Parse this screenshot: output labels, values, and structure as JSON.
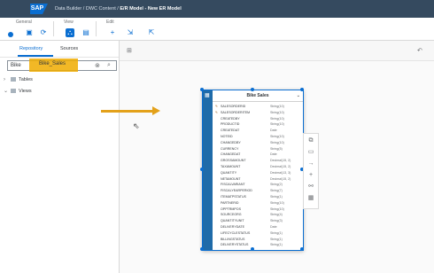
{
  "shell": {
    "logo": "SAP",
    "crumb1": "Data Builder / DWC Content /",
    "crumb2": "E/R Model - New ER Model"
  },
  "toolbar": {
    "general": "General",
    "view": "View",
    "edit": "Edit"
  },
  "left": {
    "tab_repository": "Repository",
    "tab_sources": "Sources",
    "search_value": "Bike",
    "tree": {
      "tables": "Tables",
      "views": "Views",
      "view_item": "Bike_Sales"
    }
  },
  "entity": {
    "title": "Bike Sales",
    "columns": [
      {
        "key": "✎",
        "name": "SALESORDERID",
        "type": "String(10)"
      },
      {
        "key": "✎",
        "name": "SALESORDERITEM",
        "type": "String(10)"
      },
      {
        "key": "",
        "name": "CREATEDBY",
        "type": "String(10)"
      },
      {
        "key": "",
        "name": "PRODUCTID",
        "type": "String(10)"
      },
      {
        "key": "",
        "name": "CREATEDAT",
        "type": "Date"
      },
      {
        "key": "",
        "name": "NOTEID",
        "type": "String(10)"
      },
      {
        "key": "",
        "name": "CHANGEDBY",
        "type": "String(10)"
      },
      {
        "key": "",
        "name": "CURRENCY",
        "type": "String(5)"
      },
      {
        "key": "",
        "name": "CHANGEDAT",
        "type": "Date"
      },
      {
        "key": "",
        "name": "GROSSAMOUNT",
        "type": "Decimal(15, 2)"
      },
      {
        "key": "",
        "name": "TAXAMOUNT",
        "type": "Decimal(15, 2)"
      },
      {
        "key": "",
        "name": "QUANTITY",
        "type": "Decimal(13, 3)"
      },
      {
        "key": "",
        "name": "NETAMOUNT",
        "type": "Decimal(15, 2)"
      },
      {
        "key": "",
        "name": "FISCALVARIANT",
        "type": "String(2)"
      },
      {
        "key": "",
        "name": "FISCALYEARPERIOD",
        "type": "String(7)"
      },
      {
        "key": "",
        "name": "ITEMATPSTATUS",
        "type": "String(1)"
      },
      {
        "key": "",
        "name": "PARTNERID",
        "type": "String(10)"
      },
      {
        "key": "",
        "name": "OPPTRMPOS",
        "type": "String(10)"
      },
      {
        "key": "",
        "name": "SOURCEORG",
        "type": "String(4)"
      },
      {
        "key": "",
        "name": "QUANTITYUNIT",
        "type": "String(3)"
      },
      {
        "key": "",
        "name": "DELIVERYDATE",
        "type": "Date"
      },
      {
        "key": "",
        "name": "LIFECYCLESTATUS",
        "type": "String(1)"
      },
      {
        "key": "",
        "name": "BILLINGSTATUS",
        "type": "String(1)"
      },
      {
        "key": "",
        "name": "DELIVERYSTATUS",
        "type": "String(1)"
      }
    ]
  },
  "colors": {
    "shell": "#354a5f",
    "accent": "#0a6ed1",
    "highlight": "#f0ab00",
    "arrow": "#e3a11a"
  }
}
